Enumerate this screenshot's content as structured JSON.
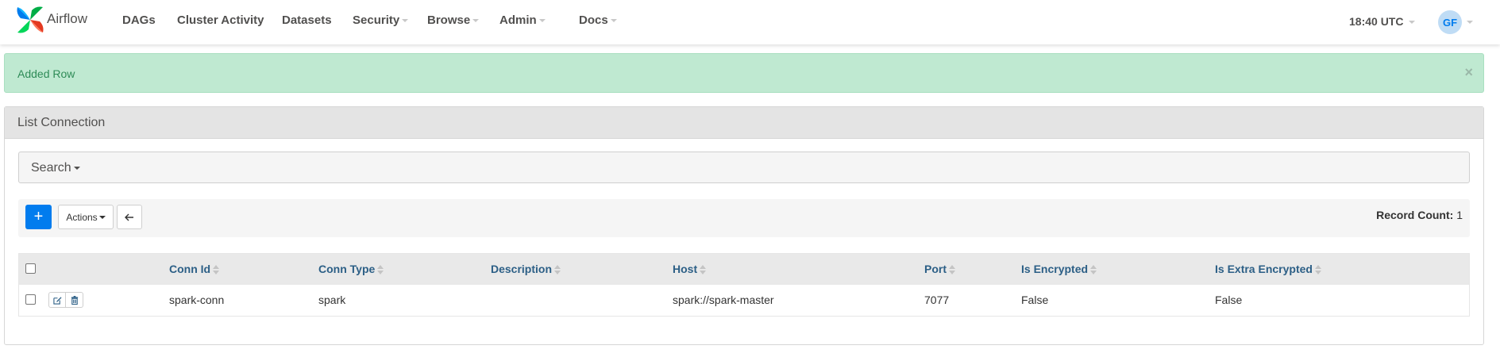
{
  "brand": {
    "name": "Airflow",
    "icon": "airflow-pinwheel-icon"
  },
  "nav": {
    "items": [
      {
        "label": "DAGs",
        "dropdown": false
      },
      {
        "label": "Cluster Activity",
        "dropdown": false
      },
      {
        "label": "Datasets",
        "dropdown": false
      },
      {
        "label": "Security",
        "dropdown": true
      },
      {
        "label": "Browse",
        "dropdown": true
      },
      {
        "label": "Admin",
        "dropdown": true
      },
      {
        "label": "Docs",
        "dropdown": true
      }
    ],
    "clock": "18:40 UTC",
    "user_initials": "GF"
  },
  "alert": {
    "message": "Added Row",
    "close_label": "×",
    "color": "#bfe9d1"
  },
  "panel": {
    "title": "List Connection",
    "search_label": "Search",
    "add_label": "+",
    "actions_label": "Actions",
    "record_count_label": "Record Count:",
    "record_count_value": "1"
  },
  "table": {
    "columns": [
      "Conn Id",
      "Conn Type",
      "Description",
      "Host",
      "Port",
      "Is Encrypted",
      "Is Extra Encrypted"
    ],
    "rows": [
      {
        "conn_id": "spark-conn",
        "conn_type": "spark",
        "description": "",
        "host": "spark://spark-master",
        "port": "7077",
        "is_encrypted": "False",
        "is_extra_encrypted": "False"
      }
    ]
  },
  "colors": {
    "primary": "#017cee",
    "header_link": "#2c5f86",
    "alert_text": "#2e8b57"
  }
}
